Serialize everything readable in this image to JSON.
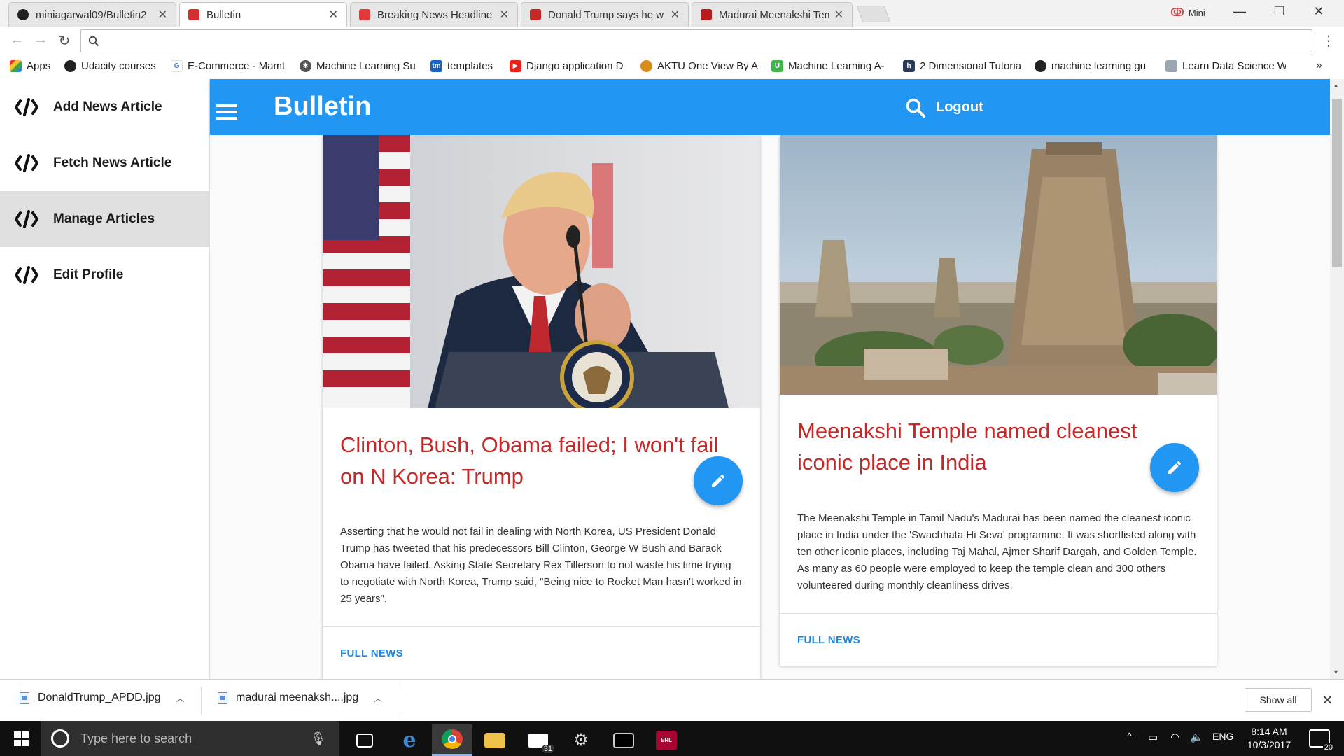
{
  "browser": {
    "tabs": [
      {
        "title": "miniagarwal09/Bulletin2",
        "icon": "github-icon",
        "color": "#222222",
        "active": false
      },
      {
        "title": "Bulletin",
        "icon": "bulletin-icon",
        "color": "#d32f2f",
        "active": true
      },
      {
        "title": "Breaking News Headline",
        "icon": "news-grid-icon",
        "color": "#e53935",
        "active": false
      },
      {
        "title": "Donald Trump says he w",
        "icon": "tnie-icon",
        "color": "#c62828",
        "active": false
      },
      {
        "title": "Madurai Meenakshi Tem",
        "icon": "news-icon",
        "color": "#b71c1c",
        "active": false
      }
    ],
    "profile_name": "Mini",
    "address_value": "",
    "bookmarks": [
      {
        "label": "Apps",
        "icon": "apps-grid-icon"
      },
      {
        "label": "Udacity courses",
        "icon": "github-icon"
      },
      {
        "label": "E-Commerce - Mamt",
        "icon": "google-icon"
      },
      {
        "label": "Machine Learning Su",
        "icon": "ml-icon"
      },
      {
        "label": "templates",
        "icon": "tm-icon"
      },
      {
        "label": "Django application D",
        "icon": "youtube-icon"
      },
      {
        "label": "AKTU One View By A",
        "icon": "aktu-icon"
      },
      {
        "label": "Machine Learning A-",
        "icon": "udemy-icon"
      },
      {
        "label": "2 Dimensional Tutoria",
        "icon": "h-icon"
      },
      {
        "label": "machine learning gu",
        "icon": "github-icon"
      },
      {
        "label": "Learn Data Science W",
        "icon": "image-icon"
      }
    ],
    "more_bookmarks": "»"
  },
  "sidebar": {
    "items": [
      {
        "label": "Add News Article",
        "active": false
      },
      {
        "label": "Fetch News Article",
        "active": false
      },
      {
        "label": "Manage Articles",
        "active": true
      },
      {
        "label": "Edit Profile",
        "active": false
      }
    ]
  },
  "appbar": {
    "brand": "Bulletin",
    "logout": "Logout",
    "color": "#2196f3"
  },
  "articles": [
    {
      "title": "Clinton, Bush, Obama failed; I won't fail on N Korea: Trump",
      "body": "Asserting that he would not fail in dealing with North Korea, US President Donald Trump has tweeted that his predecessors Bill Clinton, George W Bush and Barack Obama have failed. Asking State Secretary Rex Tillerson to not waste his time trying to negotiate with North Korea, Trump said, \"Being nice to Rocket Man hasn't worked in 25 years\".",
      "link_label": "FULL NEWS",
      "image": "podium-photo"
    },
    {
      "title": "Meenakshi Temple named cleanest iconic place in India",
      "body": "The Meenakshi Temple in Tamil Nadu's Madurai has been named the cleanest iconic place in India under the 'Swachhata Hi Seva' programme. It was shortlisted along with ten other iconic places, including Taj Mahal, Ajmer Sharif Dargah, and Golden Temple. As many as 60 people were employed to keep the temple clean and 300 others volunteered during monthly cleanliness drives.",
      "link_label": "FULL NEWS",
      "image": "temple-photo"
    }
  ],
  "downloads": {
    "items": [
      {
        "filename": "DonaldTrump_APDD.jpg"
      },
      {
        "filename": "madurai meenaksh....jpg"
      }
    ],
    "show_all": "Show all"
  },
  "taskbar": {
    "search_placeholder": "Type here to search",
    "mail_badge": "31",
    "lang": "ENG",
    "time": "8:14 AM",
    "date": "10/3/2017",
    "notifications": "20"
  }
}
